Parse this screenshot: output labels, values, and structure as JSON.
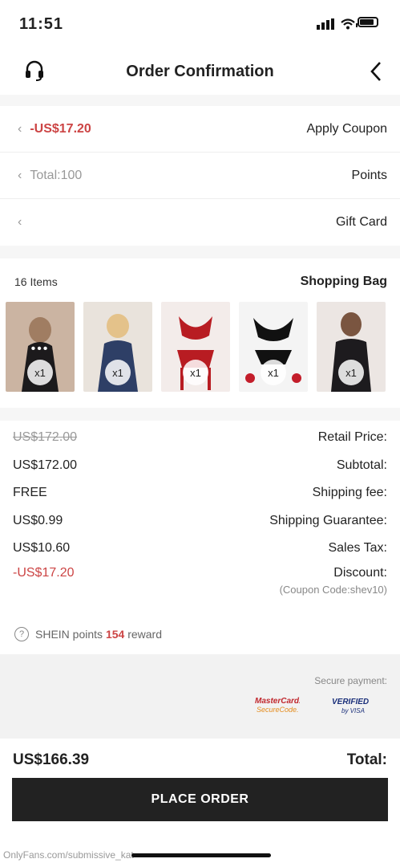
{
  "status": {
    "time": "11:51"
  },
  "header": {
    "title": "Order Confirmation"
  },
  "options": {
    "coupon": {
      "label": "Apply Coupon",
      "value": "-US$17.20"
    },
    "points": {
      "label": "Points",
      "value": "Total:100"
    },
    "gift": {
      "label": "Gift Card"
    }
  },
  "bag": {
    "title": "Shopping Bag",
    "count": "16 Items",
    "items": [
      {
        "qty": "x1",
        "color": "#d9c2b0"
      },
      {
        "qty": "x1",
        "color": "#b8c3d2"
      },
      {
        "qty": "x1",
        "color": "#e7d7d4"
      },
      {
        "qty": "x1",
        "color": "#f0f0f0"
      },
      {
        "qty": "x1",
        "color": "#2c2b2e"
      }
    ]
  },
  "summary": {
    "retail": {
      "label": "Retail Price:",
      "value": "US$172.00"
    },
    "subtotal": {
      "label": "Subtotal:",
      "value": "US$172.00"
    },
    "shipping": {
      "label": "Shipping fee:",
      "value": "FREE"
    },
    "guarantee": {
      "label": "Shipping Guarantee:",
      "value": "US$0.99"
    },
    "tax": {
      "label": "Sales Tax:",
      "value": "US$10.60"
    },
    "discount": {
      "label": "Discount:",
      "value": "-US$17.20",
      "note": "(Coupon Code:shev10)"
    }
  },
  "reward": {
    "prefix": "reward",
    "points": "154",
    "suffix": "SHEIN points"
  },
  "payment": {
    "label": "Secure payment:",
    "mastercard": "MasterCard. SecureCode.",
    "visa": "VERIFIED by VISA"
  },
  "total": {
    "label": "Total:",
    "value": "US$166.39"
  },
  "cta": {
    "label": "PLACE ORDER"
  },
  "watermark": "OnlyFans.com/submissive_kat"
}
